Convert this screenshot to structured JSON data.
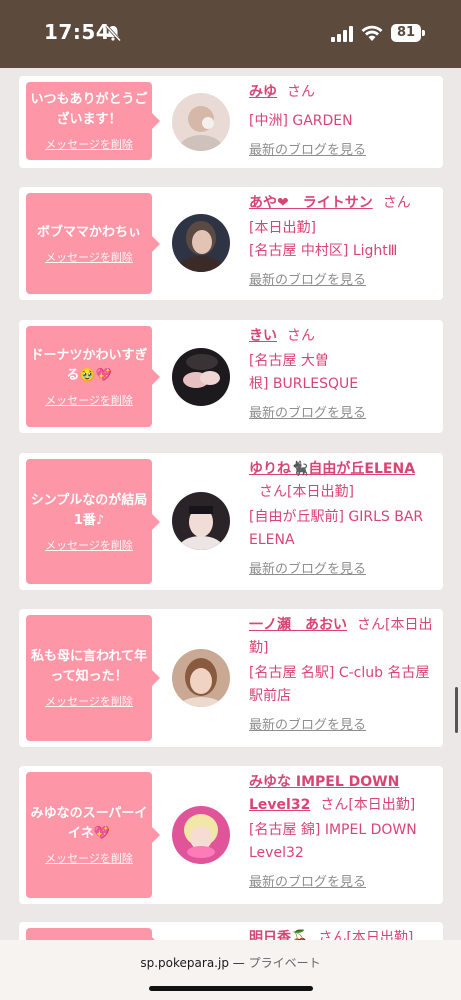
{
  "status_bar": {
    "time": "17:54",
    "battery": "81"
  },
  "cards": [
    {
      "message": "いつもありがとうございます！",
      "delete": "メッセージを削除",
      "name": "みゆ",
      "san": "さん",
      "lines": [
        "[中洲] GARDEN"
      ],
      "blog": "最新のブログを見る"
    },
    {
      "message": "ボブママかわちぃ",
      "delete": "メッセージを削除",
      "name": "あや❤︎　ライトサン",
      "san": "さん",
      "lines": [
        "[本日出勤]",
        "[名古屋 中村区] LightⅢ"
      ],
      "blog": "最新のブログを見る"
    },
    {
      "message": "ドーナツかわいすぎる🥹💖",
      "delete": "メッセージを削除",
      "name": "きい",
      "san": "さん",
      "lines": [
        "[名古屋 大曽",
        "根] BURLESQUE"
      ],
      "blog": "最新のブログを見る"
    },
    {
      "message": "シンプルなのが結局1番♪",
      "delete": "メッセージを削除",
      "name": "ゆりね🐈‍⬛自由が丘ELENA",
      "san": "さん[本日出勤]",
      "lines": [
        "[自由が丘駅前] GIRLS BAR ELENA"
      ],
      "blog": "最新のブログを見る"
    },
    {
      "message": "私も母に言われて年って知った！",
      "delete": "メッセージを削除",
      "name": "一ノ瀬　あおい",
      "san": "さん[本日出勤]",
      "lines": [
        "[名古屋 名駅] C-club 名古屋駅前店"
      ],
      "blog": "最新のブログを見る"
    },
    {
      "message": "みゆなのスーパーイイネ💖",
      "delete": "メッセージを削除",
      "name": "みゆな IMPEL DOWN Level32",
      "san": "さん[本日出勤]",
      "lines": [
        "[名古屋 錦] IMPEL DOWN Level32"
      ],
      "blog": "最新のブログを見る"
    },
    {
      "name": "明日香🍒",
      "san": "さん[本日出勤]"
    }
  ],
  "bottom_bar": {
    "domain": "sp.pokepara.jp",
    "separator": " — ",
    "private": "プライベート"
  },
  "colors": {
    "accent": "#d84575",
    "bubble": "#fd96a6",
    "status_bar": "#5c4a3c",
    "background": "#ebe8e7"
  }
}
